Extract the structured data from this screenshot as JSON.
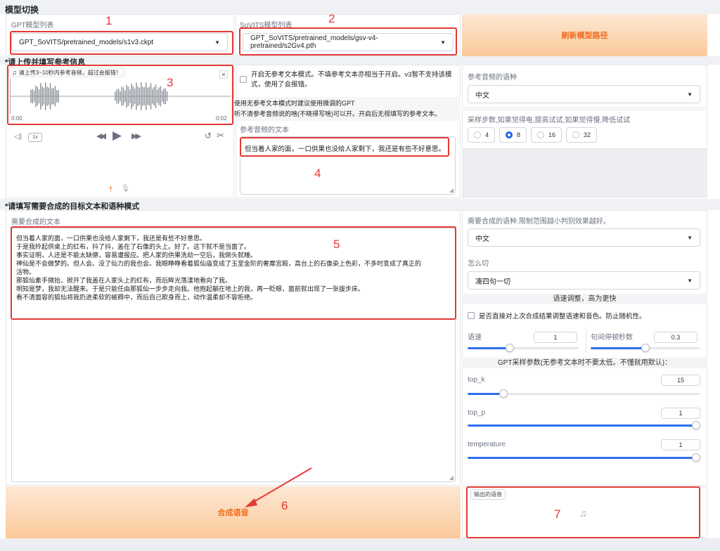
{
  "section_model": {
    "title": "模型切换",
    "gpt_label": "GPT模型列表",
    "gpt_value": "GPT_SoVITS/pretrained_models/s1v3.ckpt",
    "sovits_label": "SoVITS模型列表",
    "sovits_value": "GPT_SoVITS/pretrained_models/gsv-v4-pretrained/s2Gv4.pth",
    "refresh_label": "刷新模型路径"
  },
  "section_ref": {
    "title": "*请上传并填写参考信息",
    "audio_hint": "请上传3~10秒内参考音频，超过会报错！",
    "time_start": "0:00",
    "time_end": "0:02",
    "speed_badge": "1x",
    "no_ref_checkbox": "开启无参考文本模式。不填参考文本亦相当于开启。v3暂不支持该模式，使用了会报错。",
    "no_ref_line1": "使用无参考文本模式时建议使用微调的GPT",
    "no_ref_line2": "听不清参考音频说的啥(不晓得写啥)可以开。开启后无视填写的参考文本。",
    "ref_text_label": "参考音频的文本",
    "ref_text_value": "但当着人家的面，一口供果也没给人家剩下，我还是有些不好意思。",
    "ref_lang_label": "参考音频的语种",
    "ref_lang_value": "中文",
    "steps_label": "采样步数,如果觉得电,提高试试,如果觉得慢,降低试试",
    "steps_options": [
      "4",
      "8",
      "16",
      "32"
    ],
    "steps_selected": "8"
  },
  "section_target": {
    "title": "*请填写需要合成的目标文本和语种模式",
    "text_label": "需要合成的文本",
    "text_lines": [
      "但当着人家的面，一口供果也没给人家剩下，我还是有些不好意思。",
      "于是我拎起供桌上的红布，抖了抖，盖在了石像的头上。好了。这下就不是当面了。",
      "事实证明，人还是不能太缺德，容易遭报应。把人家的供果洗劫一空后，我倒头就睡。",
      "神仙是不会做梦的。但人会。没了仙力的我也会。我眼睁睁看着狐仙庙变成了玉堂金阶的奢靡宫殿，高台上的石像染上色彩，不多时变成了真正的",
      "活物。",
      "那狐仙素手微抬，掀开了我盖在人家头上的红布，而后眸光荡漾地看向了我。",
      "明知是梦，我却无法醒来。于是只能任由那狐仙一步步走向我。他抱起躺在地上的我，再一眨眼，面前就出现了一张拔步床。",
      "看不清面容的狐仙将我扔进柔软的被褥中，而后自己欺身而上，动作温柔却不容拒绝。"
    ],
    "target_lang_label": "需要合成的语种.限制范围越小判别效果越好。",
    "target_lang_value": "中文",
    "cut_label": "怎么切",
    "cut_value": "凑四句一切",
    "speed_header": "语速调整，高为更快",
    "continue_checkbox": "是否直接对上次合成结果调整语速和音色。防止随机性。",
    "speed_label": "语速",
    "speed_value": "1",
    "pause_label": "句间停顿秒数",
    "pause_value": "0.3",
    "gpt_params_header": "GPT采样参数(无参考文本时不要太低。不懂就用默认)：",
    "top_k_label": "top_k",
    "top_k_value": "15",
    "top_p_label": "top_p",
    "top_p_value": "1",
    "temperature_label": "temperature",
    "temperature_value": "1",
    "synth_label": "合成语音",
    "output_label": "输出的语音"
  },
  "annotations": [
    "1",
    "2",
    "3",
    "4",
    "5",
    "6",
    "7"
  ],
  "colors": {
    "accent": "#2f6fed",
    "orange": "#f06a1b",
    "annotation_red": "#e53935"
  }
}
